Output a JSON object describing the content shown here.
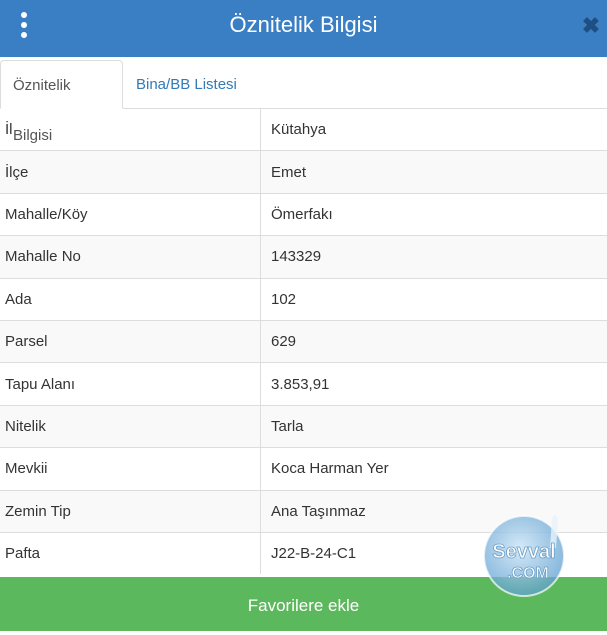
{
  "header": {
    "title": "Öznitelik Bilgisi",
    "menu_icon": "more-vertical-icon",
    "close_icon": "close-icon"
  },
  "tabs": [
    {
      "label": "Öznitelik Bilgisi",
      "active": true
    },
    {
      "label": "Bina/BB Listesi",
      "active": false
    }
  ],
  "attributes": [
    {
      "key": "İl",
      "value": "Kütahya"
    },
    {
      "key": "İlçe",
      "value": "Emet"
    },
    {
      "key": "Mahalle/Köy",
      "value": "Ömerfakı"
    },
    {
      "key": "Mahalle No",
      "value": "143329"
    },
    {
      "key": "Ada",
      "value": "102"
    },
    {
      "key": "Parsel",
      "value": "629"
    },
    {
      "key": "Tapu Alanı",
      "value": "3.853,91"
    },
    {
      "key": "Nitelik",
      "value": "Tarla"
    },
    {
      "key": "Mevkii",
      "value": "Koca Harman Yer"
    },
    {
      "key": "Zemin Tip",
      "value": "Ana Taşınmaz"
    },
    {
      "key": "Pafta",
      "value": "J22-B-24-C1"
    }
  ],
  "footer": {
    "favorite_label": "Favorilere ekle"
  },
  "watermark": {
    "line1": "Sevval",
    "line2": ".COM"
  },
  "colors": {
    "header": "#3a7fc4",
    "link": "#337ab7",
    "button": "#5cb85c"
  }
}
